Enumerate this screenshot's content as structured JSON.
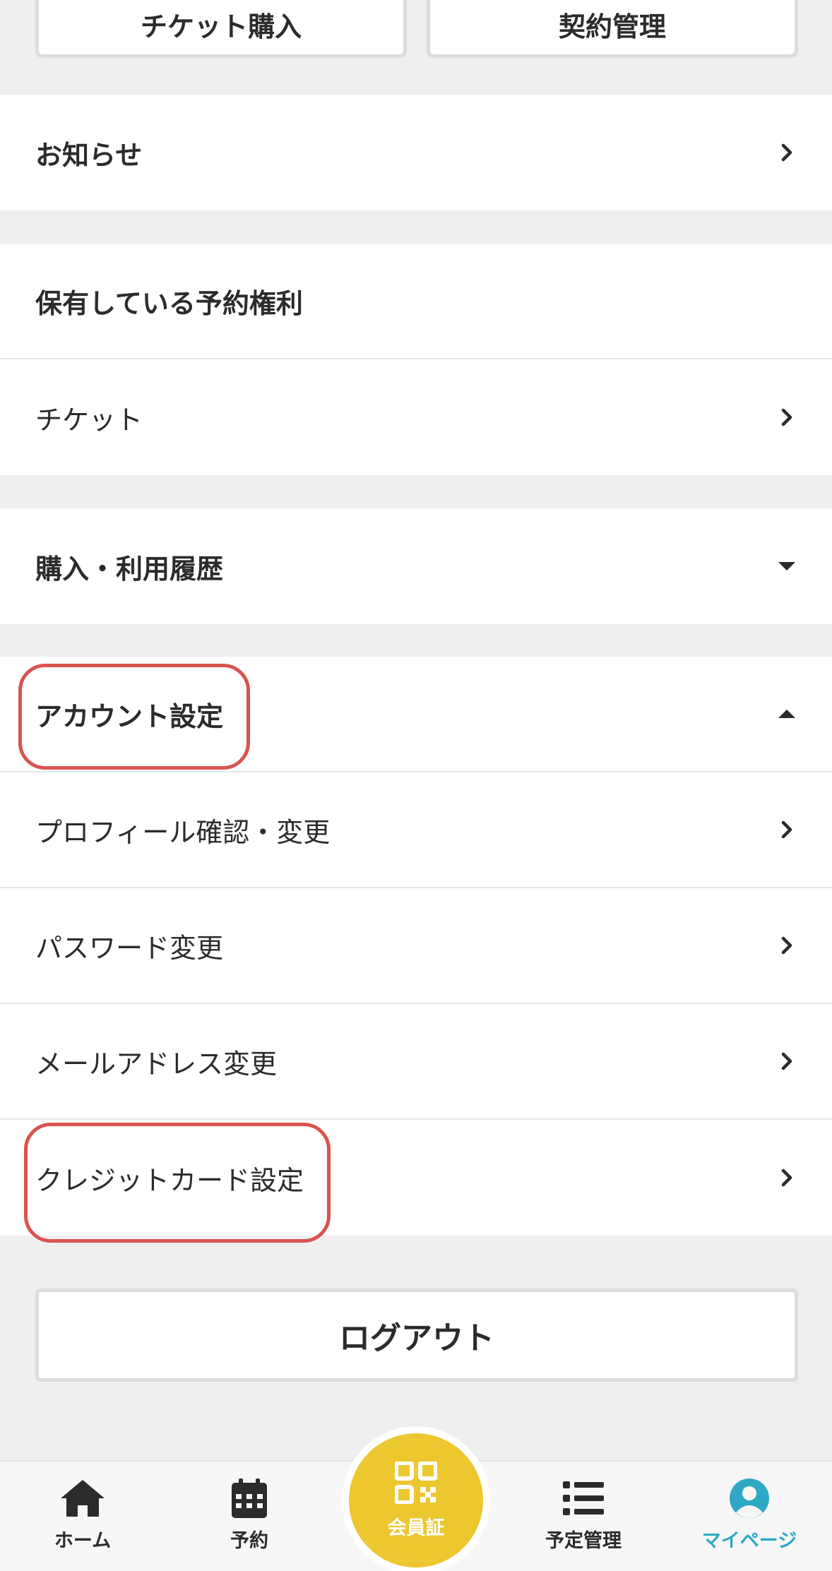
{
  "top_buttons": {
    "ticket_purchase": "チケット購入",
    "contract_management": "契約管理"
  },
  "notices": {
    "label": "お知らせ",
    "icon": "chevron-right-icon"
  },
  "reservation_rights": {
    "heading": "保有している予約権利",
    "items": [
      {
        "label": "チケット",
        "icon": "chevron-right-icon"
      }
    ]
  },
  "history": {
    "label": "購入・利用履歴",
    "icon": "caret-down-icon"
  },
  "account_settings": {
    "heading": "アカウント設定",
    "icon": "caret-up-icon",
    "items": [
      {
        "label": "プロフィール確認・変更",
        "icon": "chevron-right-icon"
      },
      {
        "label": "パスワード変更",
        "icon": "chevron-right-icon"
      },
      {
        "label": "メールアドレス変更",
        "icon": "chevron-right-icon"
      },
      {
        "label": "クレジットカード設定",
        "icon": "chevron-right-icon"
      }
    ]
  },
  "logout": {
    "label": "ログアウト"
  },
  "tabbar": {
    "items": [
      {
        "label": "ホーム",
        "icon": "home-icon",
        "active": false
      },
      {
        "label": "予約",
        "icon": "calendar-icon",
        "active": false
      },
      {
        "label": "会員証",
        "icon": "qr-code-icon",
        "active": false
      },
      {
        "label": "予定管理",
        "icon": "list-icon",
        "active": false
      },
      {
        "label": "マイページ",
        "icon": "user-icon",
        "active": true
      }
    ]
  },
  "colors": {
    "background": "#efefef",
    "text": "#2b2b2b",
    "highlight": "#d9534f",
    "accent_yellow": "#ecc72f",
    "active_tab": "#2fa8c6"
  }
}
